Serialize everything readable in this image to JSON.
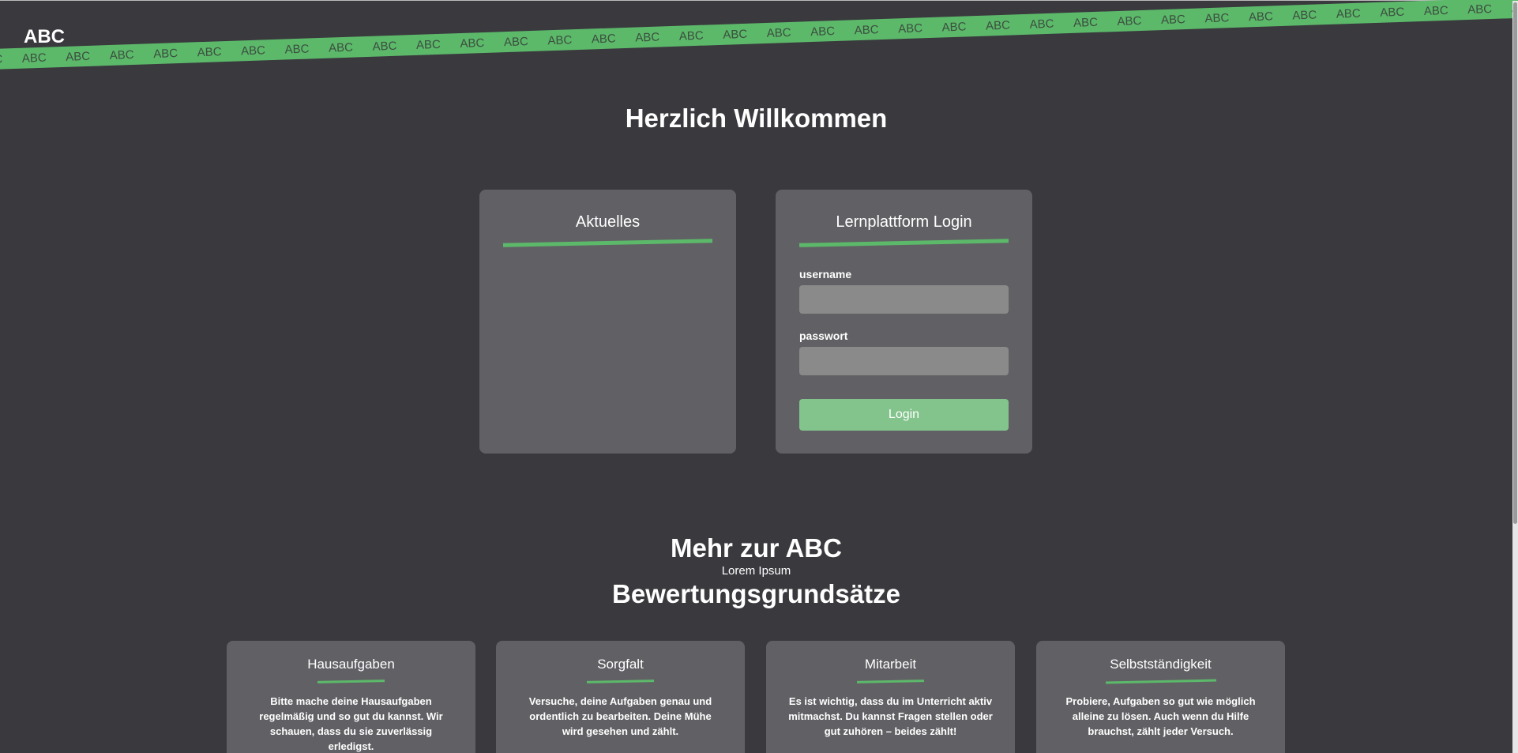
{
  "header": {
    "logo": "ABC"
  },
  "banner": {
    "text": "ABC",
    "repeat": 38
  },
  "welcome": {
    "title": "Herzlich Willkommen"
  },
  "news": {
    "title": "Aktuelles"
  },
  "login": {
    "title": "Lernplattform Login",
    "username_label": "username",
    "username_value": "",
    "password_label": "passwort",
    "password_value": "",
    "button": "Login"
  },
  "more": {
    "title": "Mehr zur ABC",
    "subtitle": "Lorem Ipsum",
    "section_title": "Bewertungsgrundsätze"
  },
  "principles": [
    {
      "title": "Hausaufgaben",
      "text": "Bitte mache deine Hausaufgaben regelmäßig und so gut du kannst. Wir schauen, dass du sie zuverlässig erledigst."
    },
    {
      "title": "Sorgfalt",
      "text": "Versuche, deine Aufgaben genau und ordentlich zu bearbeiten. Deine Mühe wird gesehen und zählt."
    },
    {
      "title": "Mitarbeit",
      "text": "Es ist wichtig, dass du im Unterricht aktiv mitmachst. Du kannst Fragen stellen oder gut zuhören – beides zählt!"
    },
    {
      "title": "Selbstständigkeit",
      "text": "Probiere, Aufgaben so gut wie möglich alleine zu lösen. Auch wenn du Hilfe brauchst, zählt jeder Versuch."
    }
  ],
  "colors": {
    "background": "#3a393e",
    "card": "#616165",
    "accent": "#5cb96a",
    "button": "#82c48c",
    "input": "#8a8a8a"
  }
}
